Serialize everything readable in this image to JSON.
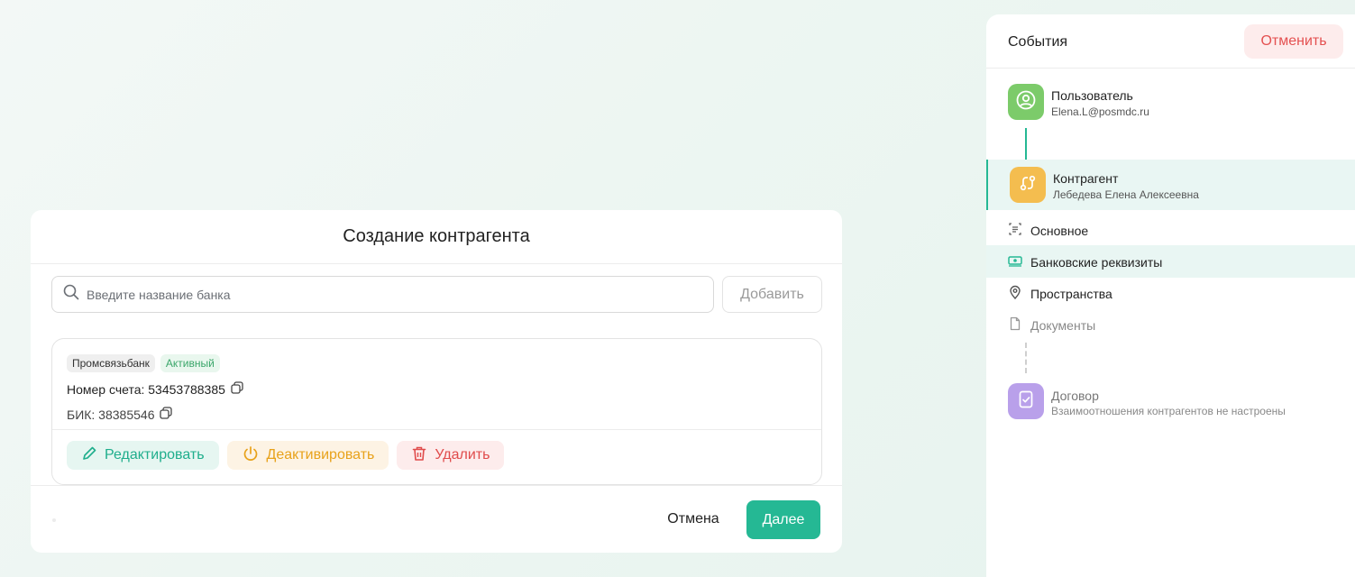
{
  "modal": {
    "title": "Создание контрагента",
    "search": {
      "placeholder": "Введите название банка",
      "value": ""
    },
    "add_button": "Добавить",
    "bank_card": {
      "bank_name": "Промсвязьбанк",
      "status": "Активный",
      "account_line": "Номер счета: 53453788385",
      "bik_line": "БИК: 38385546",
      "actions": {
        "edit": "Редактировать",
        "deactivate": "Деактивировать",
        "delete": "Удалить"
      }
    },
    "footer": {
      "cancel": "Отмена",
      "next": "Далее"
    }
  },
  "sidebar": {
    "title": "События",
    "cancel_button": "Отменить",
    "user": {
      "label": "Пользователь",
      "email": "Elena.L@posmdc.ru"
    },
    "counterparty": {
      "label": "Контрагент",
      "name": "Лебедева Елена Алексеевна"
    },
    "nav": {
      "main": "Основное",
      "bank": "Банковские реквизиты",
      "spaces": "Пространства",
      "documents": "Документы"
    },
    "contract": {
      "label": "Договор",
      "note": "Взаимоотношения контрагентов не настроены"
    }
  },
  "colors": {
    "accent": "#25b894",
    "danger": "#e04b4b",
    "warning": "#e8a21b",
    "active_badge": "#3aa66a"
  },
  "icons": [
    "search-icon",
    "copy-icon",
    "pencil-icon",
    "power-icon",
    "trash-icon",
    "user-icon",
    "swap-icon",
    "document-check-icon",
    "list-icon",
    "money-icon",
    "map-pin-icon",
    "file-icon"
  ]
}
